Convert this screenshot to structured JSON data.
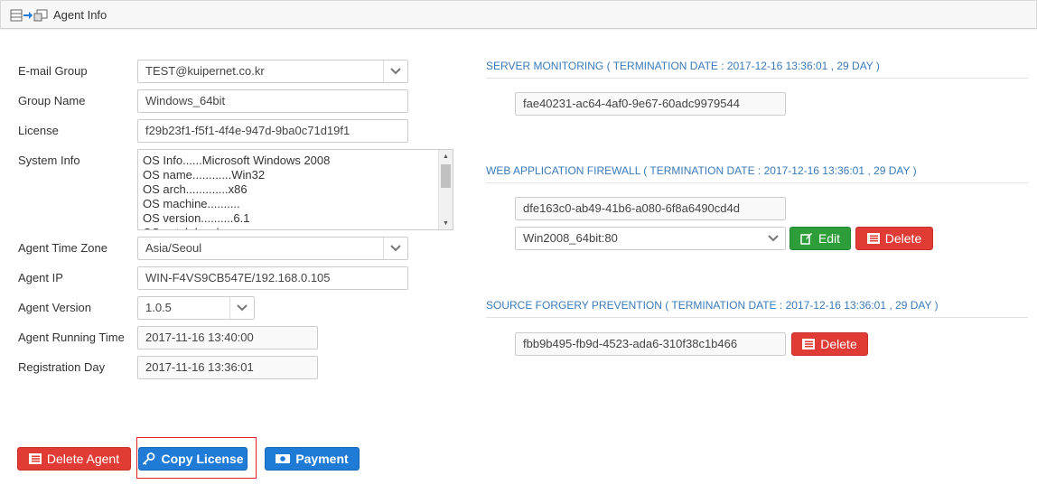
{
  "header": {
    "title": "Agent Info"
  },
  "labels": {
    "email_group": "E-mail Group",
    "group_name": "Group Name",
    "license": "License",
    "system_info": "System Info",
    "time_zone": "Agent Time Zone",
    "agent_ip": "Agent IP",
    "agent_version": "Agent Version",
    "running_time": "Agent Running Time",
    "registration_day": "Registration Day"
  },
  "values": {
    "email_group": "TEST@kuipernet.co.kr",
    "group_name": "Windows_64bit",
    "license": "f29b23f1-f5f1-4f4e-947d-9ba0c71d19f1",
    "system_info_lines": [
      "OS Info......Microsoft Windows 2008",
      "OS name............Win32",
      "OS arch.............x86",
      "OS machine..........",
      "OS version..........6.1",
      "OS patch level......"
    ],
    "time_zone": "Asia/Seoul",
    "agent_ip": "WIN-F4VS9CB547E/192.168.0.105",
    "agent_version": "1.0.5",
    "running_time": "2017-11-16 13:40:00",
    "registration_day": "2017-11-16 13:36:01"
  },
  "sections": {
    "server_monitoring": {
      "title": "SERVER MONITORING ( TERMINATION DATE : 2017-12-16 13:36:01 , 29 DAY )",
      "key": "fae40231-ac64-4af0-9e67-60adc9979544"
    },
    "waf": {
      "title": "WEB APPLICATION FIREWALL ( TERMINATION DATE : 2017-12-16 13:36:01 , 29 DAY )",
      "key": "dfe163c0-ab49-41b6-a080-6f8a6490cd4d",
      "site_select": "Win2008_64bit:80",
      "edit_label": "Edit",
      "delete_label": "Delete"
    },
    "source_forgery": {
      "title": "SOURCE FORGERY PREVENTION ( TERMINATION DATE : 2017-12-16 13:36:01 , 29 DAY )",
      "key": "fbb9b495-fb9d-4523-ada6-310f38c1b466",
      "delete_label": "Delete"
    }
  },
  "actions": {
    "delete_agent": "Delete Agent",
    "copy_license": "Copy License",
    "payment": "Payment"
  },
  "colors": {
    "accent_blue": "#1f7bd6",
    "danger_red": "#e03b35",
    "success_green": "#2e9e3a",
    "section_title_blue": "#3a7ab8",
    "highlight_red": "#e0222a"
  },
  "icons": {
    "header": [
      "list-icon",
      "arrow-right-icon",
      "windows-icon"
    ],
    "edit": "edit-icon",
    "delete": "delete-icon",
    "copy_license": "key-icon",
    "payment": "money-icon"
  }
}
